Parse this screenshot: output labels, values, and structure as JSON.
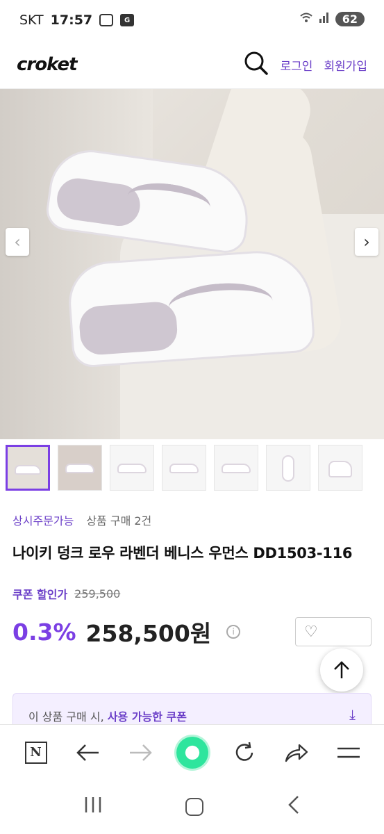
{
  "status": {
    "carrier": "SKT",
    "time": "17:57",
    "battery": "62"
  },
  "header": {
    "logo": "croket",
    "login": "로그인",
    "signup": "회원가입"
  },
  "product": {
    "availability": "상시주문가능",
    "purchase_count": "상품 구매 2건",
    "title": "나이키 덩크 로우 라벤더 베니스 우먼스 DD1503-116",
    "coupon_label": "쿠폰 할인가",
    "original_price": "259,500",
    "discount": "0.3%",
    "price": "258,500원"
  },
  "coupon_banner": {
    "prefix": "이 상품 구매 시,",
    "highlight": "사용 가능한 쿠폰"
  },
  "thumbnails": 7,
  "icons": [
    "search-icon",
    "chevron-left-icon",
    "chevron-right-icon",
    "info-icon",
    "heart-icon",
    "arrow-up-icon",
    "download-icon",
    "n-icon",
    "back-arrow-icon",
    "forward-arrow-icon",
    "green-dot-icon",
    "refresh-icon",
    "share-icon",
    "menu-icon",
    "recent-apps-icon",
    "home-icon",
    "back-icon"
  ],
  "colors": {
    "accent": "#7b3fe4",
    "link": "#6b3fc8"
  }
}
